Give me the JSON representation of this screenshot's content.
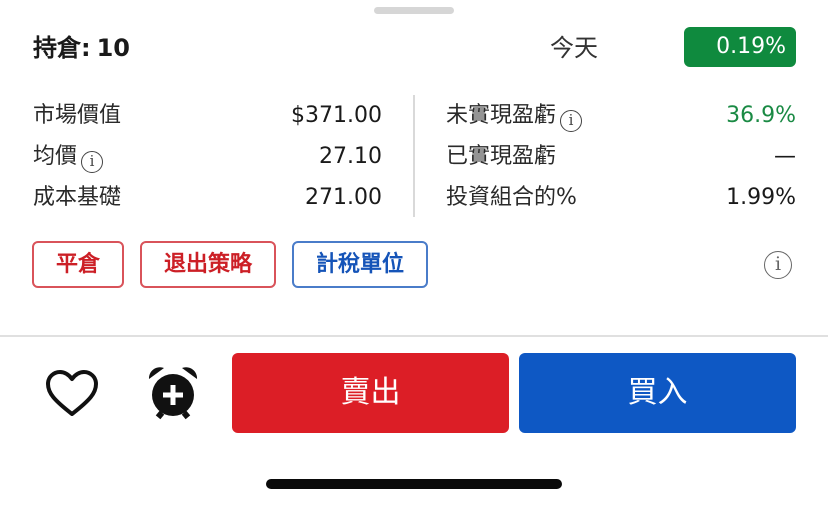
{
  "header": {
    "title_label": "持倉:",
    "quantity": "10",
    "period": "今天",
    "change_badge": "0.19%",
    "badge_color": "#0f8a3e"
  },
  "stats_left": [
    {
      "label": "市場價值",
      "value": "$371.00",
      "info": false
    },
    {
      "label": "均價",
      "value": "27.10",
      "info": true
    },
    {
      "label": "成本基礎",
      "value": "271.00",
      "info": false
    }
  ],
  "stats_right": [
    {
      "label": "未實現盈虧",
      "value": "36.9%",
      "info": true,
      "value_color": "#1a8a44"
    },
    {
      "label": "已實現盈虧",
      "value": "—",
      "info": false
    },
    {
      "label": "投資組合的%",
      "value": "1.99%",
      "info": false
    }
  ],
  "info_glyph": "i",
  "actions": {
    "close_position": "平倉",
    "exit_strategy": "退出策略",
    "tax_lots": "計稅單位"
  },
  "footer": {
    "watchlist_icon": "heart-icon",
    "alert_icon": "alarm-add-icon",
    "sell_label": "賣出",
    "buy_label": "買入",
    "sell_color": "#dc1e26",
    "buy_color": "#0e58c4"
  }
}
